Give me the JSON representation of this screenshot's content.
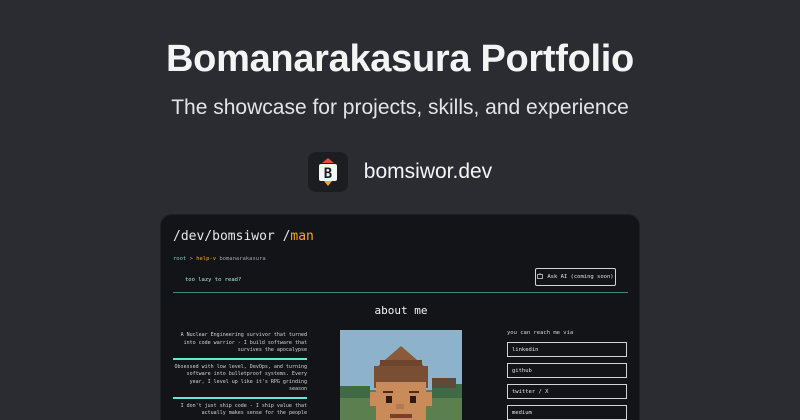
{
  "hero": {
    "title": "Bomanarakasura Portfolio",
    "subtitle": "The showcase for projects, skills, and experience",
    "brand_name": "bomsiwor.dev",
    "logo_letter": "B"
  },
  "preview": {
    "title_main": "/dev/bomsiwor /",
    "title_accent": "man",
    "path_root": "root",
    "path_sep": ">",
    "path_cmd": "help-v",
    "path_arg": "bomanarakasura",
    "lazy_text": "too lazy to read?",
    "ask_label": "Ask AI (coming soon)",
    "about_heading": "about me",
    "bio": [
      "A Nuclear Engineering survivor that turned into code warrior - I build software that survives the apocalypse",
      "Obsessed with low level, DevOps, and turning software into bulletproof systems. Every year, I level up like it's RPG grinding season",
      "I don't just ship code - I ship value that actually makes sense for the people"
    ],
    "reach_title": "you can reach me via",
    "links": [
      "linkedin",
      "github",
      "twitter / X",
      "medium"
    ]
  },
  "colors": {
    "background": "#2a2c31",
    "card": "#131418",
    "accent_orange": "#f6a623",
    "accent_teal": "#5eead4"
  }
}
